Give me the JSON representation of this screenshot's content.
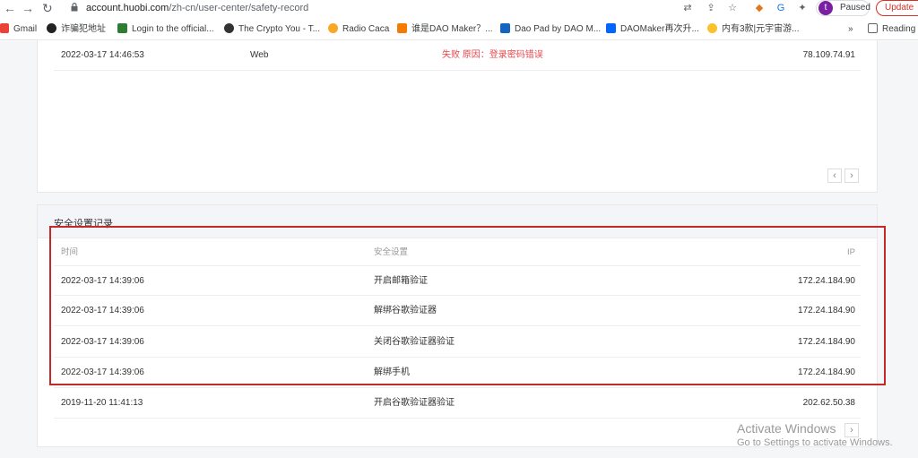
{
  "browser": {
    "url_host": "account.huobi.com",
    "url_path": "/zh-cn/user-center/safety-record",
    "profile_initial": "t",
    "paused_label": "Paused",
    "update_label": "Update",
    "bookmarks": [
      {
        "label": "Gmail",
        "icon": "gmail-icon",
        "color": "#ea4335"
      },
      {
        "label": "诈骗犯地址",
        "icon": "coin-icon",
        "color": "#222222"
      },
      {
        "label": "Login to the official...",
        "icon": "login-icon",
        "color": "#2e7d32"
      },
      {
        "label": "The Crypto You - T...",
        "icon": "crypto-you-icon",
        "color": "#333333"
      },
      {
        "label": "Radio Caca",
        "icon": "radio-caca-icon",
        "color": "#f9a825"
      },
      {
        "label": "谁是DAO Maker？...",
        "icon": "dao-icon",
        "color": "#f57c00"
      },
      {
        "label": "Dao Pad by DAO M...",
        "icon": "daopad-icon",
        "color": "#1565c0"
      },
      {
        "label": "DAOMaker再次升...",
        "icon": "zhihu-icon",
        "color": "#0066ff"
      },
      {
        "label": "内有3款|元宇宙游...",
        "icon": "heart-icon",
        "color": "#fbc02d"
      }
    ],
    "more_label": "»",
    "reading_label": "Reading"
  },
  "login_record": {
    "rows": [
      {
        "time": "2022-03-17 14:46:53",
        "device": "Web",
        "status": "失败 原因：登录密码错误",
        "ip": "78.109.74.91"
      }
    ]
  },
  "security_record": {
    "title": "安全设置记录",
    "headers": {
      "time": "时间",
      "setting": "安全设置",
      "ip": "IP"
    },
    "rows": [
      {
        "time": "2022-03-17 14:39:06",
        "setting": "开启邮箱验证",
        "ip": "172.24.184.90"
      },
      {
        "time": "2022-03-17 14:39:06",
        "setting": "解绑谷歌验证器",
        "ip": "172.24.184.90"
      },
      {
        "time": "2022-03-17 14:39:06",
        "setting": "关闭谷歌验证器验证",
        "ip": "172.24.184.90"
      },
      {
        "time": "2022-03-17 14:39:06",
        "setting": "解绑手机",
        "ip": "172.24.184.90"
      },
      {
        "time": "2019-11-20 11:41:13",
        "setting": "开启谷歌验证器验证",
        "ip": "202.62.50.38"
      }
    ]
  },
  "watermark": {
    "line1": "Activate Windows",
    "line2": "Go to Settings to activate Windows."
  },
  "colors": {
    "highlight": "#c62828",
    "fail_text": "#e5484d"
  }
}
